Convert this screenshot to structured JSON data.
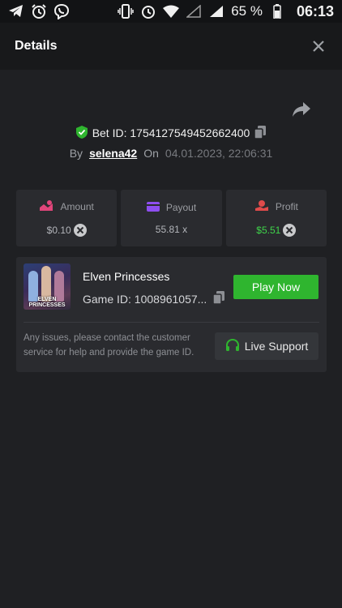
{
  "status_bar": {
    "left_icons": [
      "telegram-icon",
      "alarm-icon",
      "viber-icon"
    ],
    "right_icons": [
      "vibrate-icon",
      "alarm-icon",
      "wifi-icon",
      "signal-empty-icon",
      "signal-icon"
    ],
    "battery": "65 %",
    "time": "06:13"
  },
  "header": {
    "title": "Details"
  },
  "bet": {
    "id_label": "Bet ID: 1754127549452662400",
    "by_label": "By",
    "username": "selena42",
    "on_label": "On",
    "date": "04.01.2023, 22:06:31"
  },
  "stats": [
    {
      "label": "Amount",
      "value": "$0.10",
      "icon": "amount-icon",
      "color": "#e0457a"
    },
    {
      "label": "Payout",
      "value": "55.81 x",
      "icon": "payout-card-icon",
      "color": "#8e4ef0"
    },
    {
      "label": "Profit",
      "value": "$5.51",
      "icon": "profit-icon",
      "color": "#e04b4b"
    }
  ],
  "game": {
    "name": "Elven Princesses",
    "game_id": "Game ID: 1008961057...",
    "thumb_text": "ELVEN PRINCESSES",
    "play_label": "Play Now"
  },
  "support": {
    "text": "Any issues, please contact the customer service for help and provide the game ID.",
    "button_label": "Live Support"
  },
  "colors": {
    "accent_green": "#2fb52f",
    "profit_green": "#3fd34a",
    "bg": "#1f2023",
    "card": "#2a2b2f"
  }
}
